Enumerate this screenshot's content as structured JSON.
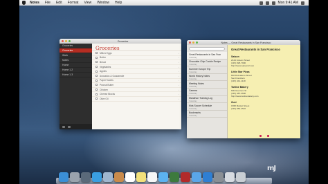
{
  "menubar": {
    "app": "Notes",
    "items": [
      "File",
      "Edit",
      "Format",
      "View",
      "Window",
      "Help"
    ],
    "clock": "Mon 9:41 AM"
  },
  "win1": {
    "title": "Groceries",
    "sidebar": [
      "Groceries",
      "Groceries",
      "Work",
      "Notes",
      "Home",
      "Home 1.2",
      "Home 1.3"
    ],
    "note_title": "Groceries",
    "items": [
      "Milk & Eggs",
      "Butter",
      "Bread",
      "Vegetables",
      "Apples",
      "Avocados & Guacamole",
      "Paper Towels",
      "Peanut Butter",
      "Chicken",
      "Cheese Blocks",
      "Olive Oil"
    ]
  },
  "win2": {
    "title": "Notes — Great Restaurants in San Francisco",
    "list": [
      {
        "title": "Great Restaurants in San Fran",
        "sub": "Yesterday"
      },
      {
        "title": "Chocolate Chip Cookie Recipe",
        "sub": "Yesterday"
      },
      {
        "title": "Summer Europe Trip",
        "sub": "Yesterday"
      },
      {
        "title": "World History Notes",
        "sub": "Yesterday"
      },
      {
        "title": "Meeting Notes",
        "sub": "Yesterday"
      },
      {
        "title": "Camera",
        "sub": "Yesterday"
      },
      {
        "title": "Marathon Training Log",
        "sub": "Yesterday"
      },
      {
        "title": "Kids Soccer Schedule",
        "sub": "Yesterday"
      },
      {
        "title": "Bookmarks",
        "sub": "Yesterday"
      }
    ],
    "detail_title": "Great Restaurants in San Francisco",
    "blocks": [
      {
        "name": "Saison",
        "lines": [
          "2124 Folsom Street",
          "(415) 828-7990",
          "http://www.saisonsf.com"
        ]
      },
      {
        "name": "Little Star Pizza",
        "lines": [
          "846 Divisadero Street",
          "San Francisco",
          "(415) 441-1118"
        ]
      },
      {
        "name": "Tartine Bakery",
        "lines": [
          "600 Guerrero St",
          "(415) 487-2600",
          "http://www.tartinebakery.com"
        ]
      },
      {
        "name": "Zuni",
        "lines": [
          "1658 Market Street",
          "(415) 552-2522"
        ]
      }
    ]
  },
  "dock": {
    "icons": [
      {
        "name": "finder-icon",
        "color": "#3b8fd6"
      },
      {
        "name": "launchpad-icon",
        "color": "#9aa3ad"
      },
      {
        "name": "mission-control-icon",
        "color": "#5a6a7a"
      },
      {
        "name": "safari-icon",
        "color": "#3a9ee0"
      },
      {
        "name": "mail-icon",
        "color": "#9fb6cf"
      },
      {
        "name": "contacts-icon",
        "color": "#c98b4c"
      },
      {
        "name": "calendar-icon",
        "color": "#ffffff"
      },
      {
        "name": "notes-icon",
        "color": "#f2e07a"
      },
      {
        "name": "reminders-icon",
        "color": "#f6f6f6"
      },
      {
        "name": "messages-icon",
        "color": "#5cb2f0"
      },
      {
        "name": "facetime-icon",
        "color": "#3d7a3d"
      },
      {
        "name": "photo-booth-icon",
        "color": "#b22a2a"
      },
      {
        "name": "itunes-icon",
        "color": "#5aa6e8"
      },
      {
        "name": "app-store-icon",
        "color": "#2f7fd3"
      },
      {
        "name": "system-preferences-icon",
        "color": "#8a8f95"
      },
      {
        "name": "downloads-icon",
        "color": "#d7dbe1"
      },
      {
        "name": "trash-icon",
        "color": "#c9ced4"
      }
    ]
  },
  "watermark": "mJ"
}
